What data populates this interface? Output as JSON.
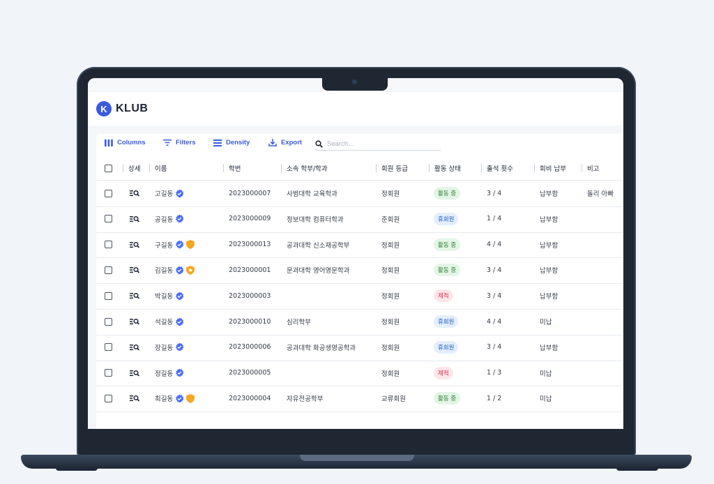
{
  "app": {
    "logo_letter": "K",
    "name": "KLUB"
  },
  "toolbar": {
    "columns": "Columns",
    "filters": "Filters",
    "density": "Density",
    "export": "Export",
    "search_placeholder": "Search..."
  },
  "columns": {
    "detail": "상세",
    "name": "이름",
    "student_id": "학번",
    "department": "소속 학부/학과",
    "grade": "회원 등급",
    "status": "활동 상태",
    "attendance": "출석 횟수",
    "fee": "회비 납부",
    "note": "비고"
  },
  "rows": [
    {
      "name": "고길동",
      "badges": [
        "verified"
      ],
      "student_id": "2023000007",
      "department": "사범대학 교육학과",
      "grade": "정회원",
      "status": "활동 중",
      "status_color": "green",
      "attendance": "3 / 4",
      "fee": "납부함",
      "note": "돌리 아빠"
    },
    {
      "name": "공길동",
      "badges": [
        "verified"
      ],
      "student_id": "2023000009",
      "department": "정보대학 컴퓨터학과",
      "grade": "준회원",
      "status": "휴회원",
      "status_color": "blue",
      "attendance": "1 / 4",
      "fee": "납부함",
      "note": ""
    },
    {
      "name": "구길동",
      "badges": [
        "verified",
        "shield"
      ],
      "student_id": "2023000013",
      "department": "공과대학 신소재공학부",
      "grade": "정회원",
      "status": "활동 중",
      "status_color": "green",
      "attendance": "4 / 4",
      "fee": "납부함",
      "note": ""
    },
    {
      "name": "김길동",
      "badges": [
        "verified",
        "star-shield"
      ],
      "student_id": "2023000001",
      "department": "문과대학 영어영문학과",
      "grade": "정회원",
      "status": "활동 중",
      "status_color": "green",
      "attendance": "3 / 4",
      "fee": "납부함",
      "note": ""
    },
    {
      "name": "박길동",
      "badges": [
        "verified"
      ],
      "student_id": "2023000003",
      "department": "",
      "grade": "정회원",
      "status": "제적",
      "status_color": "red",
      "attendance": "3 / 4",
      "fee": "납부함",
      "note": ""
    },
    {
      "name": "석길동",
      "badges": [
        "verified"
      ],
      "student_id": "2023000010",
      "department": "심리학부",
      "grade": "정회원",
      "status": "휴회원",
      "status_color": "blue",
      "attendance": "4 / 4",
      "fee": "미납",
      "note": ""
    },
    {
      "name": "장길동",
      "badges": [
        "verified"
      ],
      "student_id": "2023000006",
      "department": "공과대학 화공생명공학과",
      "grade": "정회원",
      "status": "휴회원",
      "status_color": "blue",
      "attendance": "3 / 4",
      "fee": "납부함",
      "note": ""
    },
    {
      "name": "정길동",
      "badges": [
        "verified"
      ],
      "student_id": "2023000005",
      "department": "",
      "grade": "정회원",
      "status": "제적",
      "status_color": "red",
      "attendance": "1 / 3",
      "fee": "미납",
      "note": ""
    },
    {
      "name": "최길동",
      "badges": [
        "verified",
        "shield"
      ],
      "student_id": "2023000004",
      "department": "자유전공학부",
      "grade": "교류회원",
      "status": "활동 중",
      "status_color": "green",
      "attendance": "1 / 2",
      "fee": "미납",
      "note": ""
    }
  ],
  "colors": {
    "accent": "#3b5bdb",
    "verified": "#4c6ef5",
    "shield": "#f5a623"
  }
}
